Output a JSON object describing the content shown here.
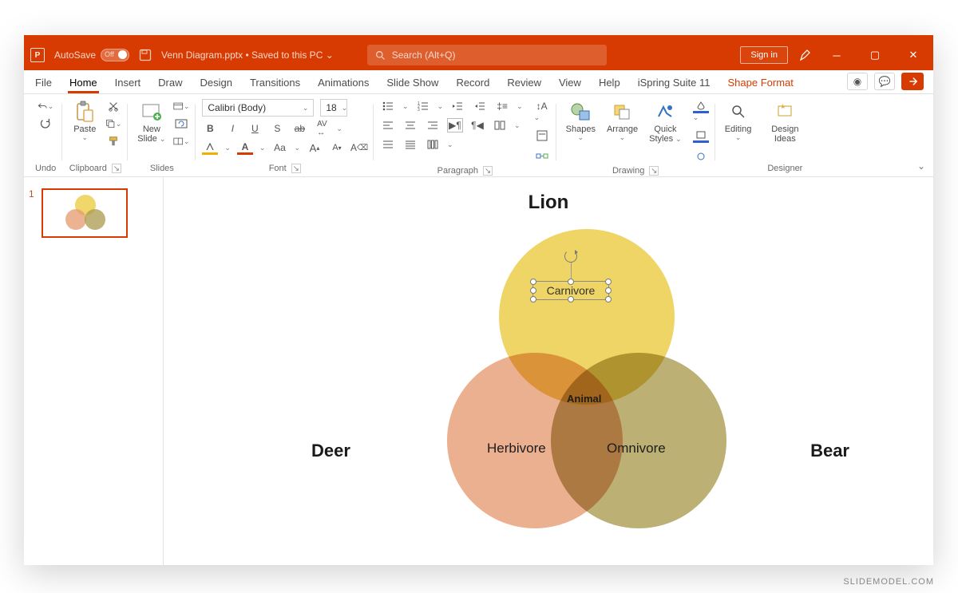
{
  "titlebar": {
    "autosave_label": "AutoSave",
    "autosave_state": "Off",
    "doc_title": "Venn Diagram.pptx • Saved to this PC ⌄",
    "search_placeholder": "Search (Alt+Q)",
    "signin": "Sign in"
  },
  "tabs": {
    "file": "File",
    "home": "Home",
    "insert": "Insert",
    "draw": "Draw",
    "design": "Design",
    "transitions": "Transitions",
    "animations": "Animations",
    "slideshow": "Slide Show",
    "record": "Record",
    "review": "Review",
    "view": "View",
    "help": "Help",
    "ispring": "iSpring Suite 11",
    "shapeformat": "Shape Format"
  },
  "ribbon": {
    "undo": "Undo",
    "clipboard": "Clipboard",
    "paste": "Paste",
    "slides": "Slides",
    "new_slide": "New",
    "new_slide2": "Slide",
    "font": "Font",
    "font_name": "Calibri (Body)",
    "font_size": "18",
    "paragraph": "Paragraph",
    "drawing": "Drawing",
    "shapes": "Shapes",
    "arrange": "Arrange",
    "quick": "Quick",
    "styles": "Styles",
    "editing": "Editing",
    "designer": "Designer",
    "design_ideas1": "Design",
    "design_ideas2": "Ideas",
    "aa": "Aa"
  },
  "thumbs": {
    "num1": "1"
  },
  "venn": {
    "top_label": "Lion",
    "left_label": "Deer",
    "right_label": "Bear",
    "top_inner": "Carnivore",
    "left_inner": "Herbivore",
    "right_inner": "Omnivore",
    "center": "Animal",
    "colors": {
      "top": "#eac93b",
      "left": "#e59a6f",
      "right": "#a99a4e"
    }
  },
  "watermark": "SLIDEMODEL.COM"
}
